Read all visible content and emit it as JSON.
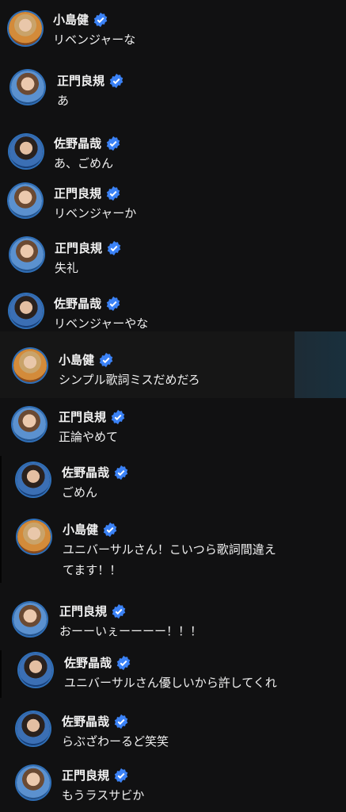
{
  "messages": [
    {
      "user": "小島健",
      "text": "リベンジャーな",
      "avatar": "kojima"
    },
    {
      "user": "正門良規",
      "text": "あ",
      "avatar": "shomon"
    },
    {
      "user": "佐野晶哉",
      "text": "あ、ごめん",
      "avatar": "sano"
    },
    {
      "user": "正門良規",
      "text": "リベンジャーか",
      "avatar": "shomon"
    },
    {
      "user": "正門良規",
      "text": "失礼",
      "avatar": "shomon"
    },
    {
      "user": "佐野晶哉",
      "text": "リベンジャーやな",
      "avatar": "sano"
    },
    {
      "user": "小島健",
      "text": "シンプル歌詞ミスだめだろ",
      "avatar": "kojima"
    },
    {
      "user": "正門良規",
      "text": "正論やめて",
      "avatar": "shomon"
    },
    {
      "user": "佐野晶哉",
      "text": "ごめん",
      "avatar": "sano"
    },
    {
      "user": "小島健",
      "text": "ユニバーサルさん！こいつら歌詞間違え",
      "text2": "てます！！",
      "avatar": "kojima"
    },
    {
      "user": "正門良規",
      "text": "おーーいぇーーーー！！！",
      "avatar": "shomon"
    },
    {
      "user": "佐野晶哉",
      "text": "ユニバーサルさん優しいから許してくれ",
      "avatar": "sano"
    },
    {
      "user": "佐野晶哉",
      "text": "らぶざわーるど笑笑",
      "avatar": "sano"
    },
    {
      "user": "正門良規",
      "text": "もうラスサビか",
      "avatar": "shomon"
    }
  ],
  "icons": {
    "verified": "verified-badge-icon"
  },
  "colors": {
    "background": "#111112",
    "verified": "#3b82f6",
    "text": "#f0f0f0"
  }
}
